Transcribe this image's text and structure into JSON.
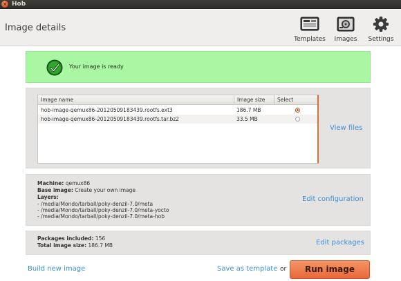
{
  "window": {
    "title": "Hob",
    "close_glyph": "×"
  },
  "header": {
    "title": "Image details",
    "toolbar": [
      {
        "label": "Templates",
        "icon": "templates-icon"
      },
      {
        "label": "Images",
        "icon": "images-icon"
      },
      {
        "label": "Settings",
        "icon": "settings-icon"
      }
    ]
  },
  "status": {
    "icon": "checkmark-icon",
    "text": "Your image is ready",
    "color": "#a9f7a2"
  },
  "files": {
    "columns": [
      "Image name",
      "Image size",
      "Select"
    ],
    "rows": [
      {
        "name": "hob-image-qemux86-20120509183439.rootfs.ext3",
        "size": "186.7 MB",
        "selected": true
      },
      {
        "name": "hob-image-qemux86-20120509183439.rootfs.tar.bz2",
        "size": "33.5 MB",
        "selected": false
      }
    ],
    "view_files_label": "View files"
  },
  "config": {
    "machine_label": "Machine:",
    "machine_value": "qemux86",
    "base_image_label": "Base image:",
    "base_image_value": "Create your own image",
    "layers_label": "Layers:",
    "layers": [
      "- /media/Mondo/tarball/poky-denzil-7.0/meta",
      "- /media/Mondo/tarball/poky-denzil-7.0/meta-yocto",
      "- /media/Mondo/tarball/poky-denzil-7.0/meta-hob"
    ],
    "edit_label": "Edit configuration"
  },
  "packages": {
    "included_label": "Packages included:",
    "included_value": "156",
    "total_size_label": "Total image size:",
    "total_size_value": "186.7 MB",
    "edit_label": "Edit packages"
  },
  "actions": {
    "build_new_label": "Build new image",
    "save_template_label": "Save as template",
    "or_text": "or",
    "run_label": "Run image"
  },
  "colors": {
    "accent_link": "#3c8fd8",
    "run_button": "#e8683a",
    "selection_bar": "#e66a2e"
  }
}
